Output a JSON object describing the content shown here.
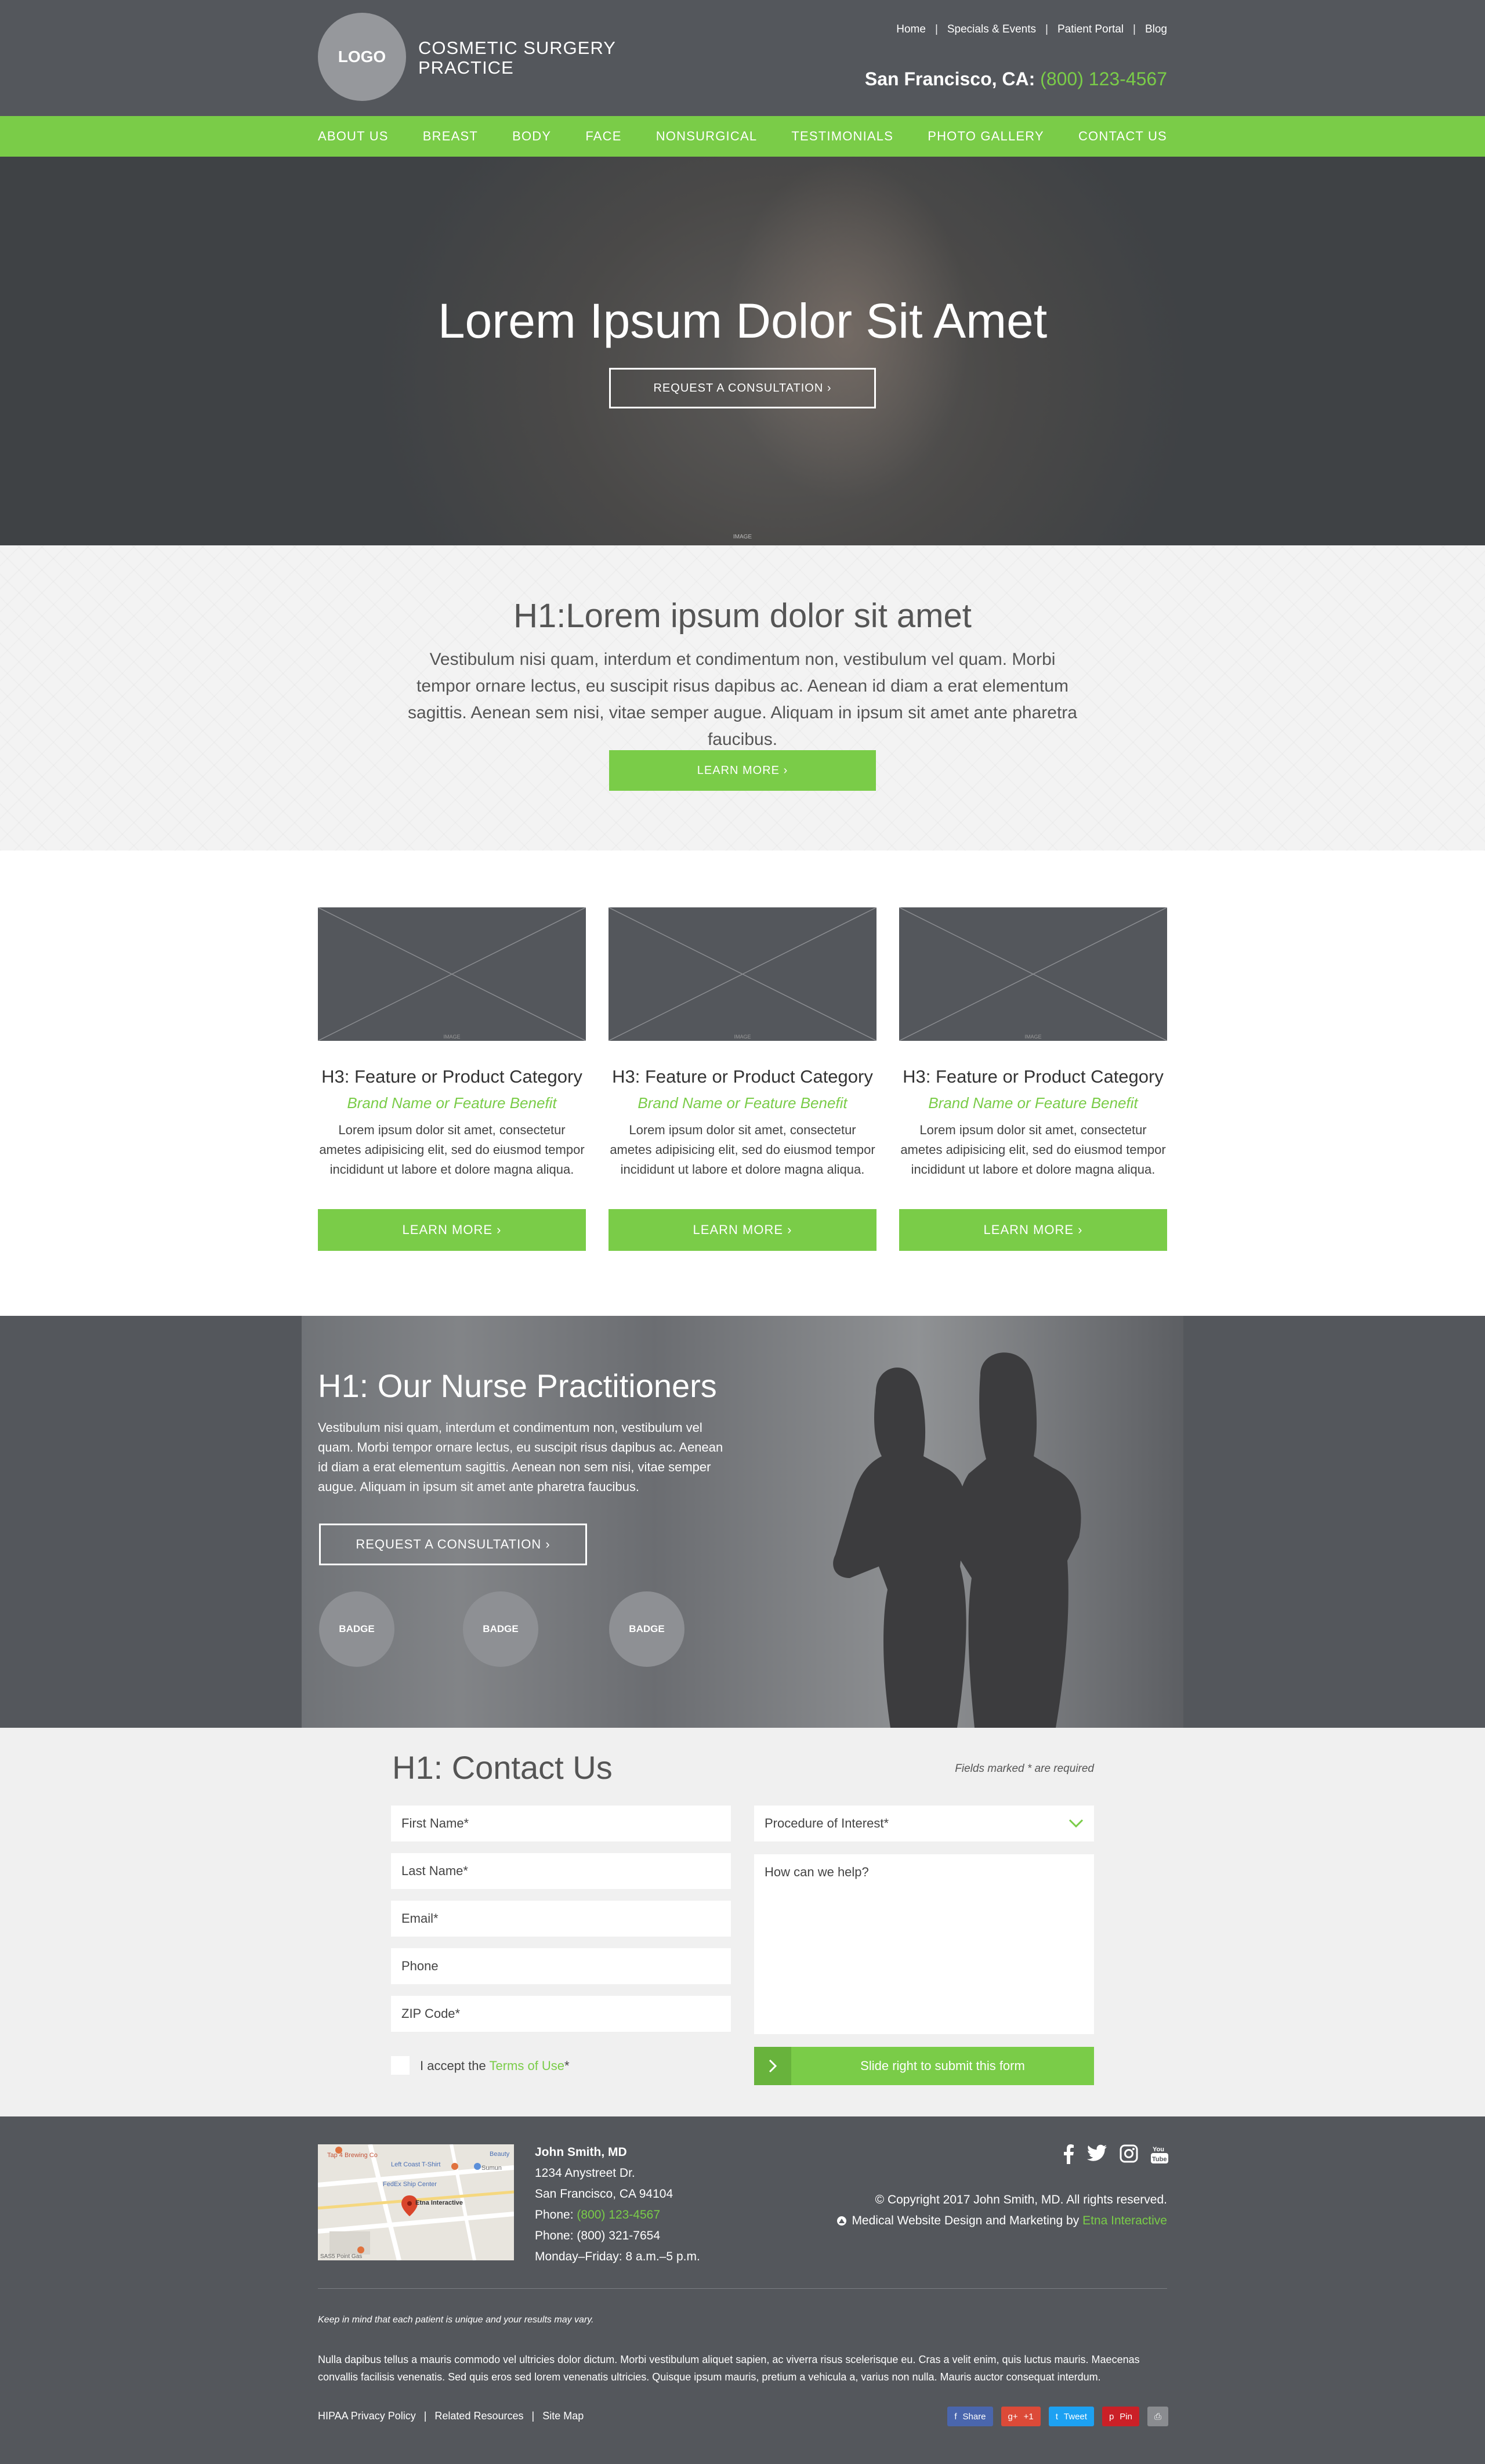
{
  "header": {
    "logo": "LOGO",
    "practice_line1": "COSMETIC SURGERY",
    "practice_line2": "PRACTICE",
    "links": [
      "Home",
      "Specials & Events",
      "Patient Portal",
      "Blog"
    ],
    "location": "San Francisco, CA:",
    "phone": "(800) 123-4567"
  },
  "nav": [
    "ABOUT US",
    "BREAST",
    "BODY",
    "FACE",
    "NONSURGICAL",
    "TESTIMONIALS",
    "PHOTO GALLERY",
    "CONTACT US"
  ],
  "hero": {
    "title": "Lorem Ipsum Dolor Sit Amet",
    "button": "REQUEST A CONSULTATION ›",
    "caption": "IMAGE"
  },
  "intro": {
    "title": "H1:Lorem ipsum dolor sit amet",
    "text": "Vestibulum nisi quam, interdum et condimentum non, vestibulum vel quam. Morbi tempor ornare lectus, eu suscipit risus dapibus ac. Aenean id diam a erat elementum sagittis. Aenean sem nisi, vitae semper augue. Aliquam in ipsum sit amet ante pharetra faucibus.",
    "button": "LEARN MORE ›"
  },
  "features": [
    {
      "image_label": "IMAGE",
      "title": "H3: Feature or Product Category",
      "subtitle": "Brand Name or Feature Benefit",
      "text": "Lorem ipsum dolor sit amet, consectetur ametes adipisicing elit, sed do eiusmod tempor incididunt ut labore et dolore magna aliqua.",
      "button": "LEARN MORE ›"
    },
    {
      "image_label": "IMAGE",
      "title": "H3: Feature or Product Category",
      "subtitle": "Brand Name or Feature Benefit",
      "text": "Lorem ipsum dolor sit amet, consectetur ametes adipisicing elit, sed do eiusmod tempor incididunt ut labore et dolore magna aliqua.",
      "button": "LEARN MORE ›"
    },
    {
      "image_label": "IMAGE",
      "title": "H3: Feature or Product Category",
      "subtitle": "Brand Name or Feature Benefit",
      "text": "Lorem ipsum dolor sit amet, consectetur ametes adipisicing elit, sed do eiusmod tempor incididunt ut labore et dolore magna aliqua.",
      "button": "LEARN MORE ›"
    }
  ],
  "nurse": {
    "title": "H1: Our Nurse Practitioners",
    "text": "Vestibulum nisi quam, interdum et condimentum non, vestibulum vel quam. Morbi tempor ornare lectus, eu suscipit risus dapibus ac. Aenean id diam a erat elementum sagittis. Aenean non sem nisi, vitae semper augue. Aliquam in ipsum sit amet ante pharetra faucibus.",
    "button": "REQUEST A CONSULTATION ›",
    "badges": [
      "BADGE",
      "BADGE",
      "BADGE"
    ]
  },
  "contact": {
    "title": "H1: Contact Us",
    "required_note": "Fields marked * are required",
    "fields": [
      "First Name*",
      "Last Name*",
      "Email*",
      "Phone",
      "ZIP Code*"
    ],
    "procedure_placeholder": "Procedure of Interest*",
    "help_placeholder": "How can we help?",
    "terms_prefix": "I accept the ",
    "terms_link": "Terms of Use",
    "terms_suffix": "*",
    "slide_label": "Slide right to submit this form"
  },
  "footer": {
    "map_labels": [
      "Tap 4 Brewing Co",
      "Left Coast T-Shirt",
      "FedEx Ship Center",
      "Etna Interactive",
      "Sumun",
      "Beauty",
      "SAS5 Point Gas"
    ],
    "name": "John Smith, MD",
    "street": "1234 Anystreet Dr.",
    "city": "San Francisco, CA 94104",
    "phone_label": "Phone: ",
    "phone1": "(800) 123-4567",
    "phone2": "Phone: (800) 321-7654",
    "hours": "Monday–Friday: 8 a.m.–5 p.m.",
    "social_icons": [
      "facebook-icon",
      "twitter-icon",
      "instagram-icon",
      "youtube-icon"
    ],
    "copyright": "© Copyright 2017 John Smith, MD. All rights reserved.",
    "credit_prefix": "Medical Website Design and Marketing by ",
    "credit_link": "Etna Interactive",
    "disclaimer": "Keep in mind that each patient is unique and your results may vary.",
    "lorem": "Nulla dapibus tellus a mauris commodo vel ultricies dolor dictum. Morbi vestibulum aliquet sapien, ac viverra risus scelerisque eu. Cras a velit enim, quis luctus mauris. Maecenas convallis facilisis venenatis. Sed quis eros sed lorem venenatis ultricies. Quisque ipsum mauris, pretium a vehicula a, varius non nulla. Mauris auctor consequat interdum.",
    "links": [
      "HIPAA Privacy Policy",
      "Related Resources",
      "Site Map"
    ],
    "share": [
      {
        "label": "Share",
        "glyph": "f",
        "color": "#4a66ad"
      },
      {
        "label": "+1",
        "glyph": "g+",
        "color": "#dc4a38"
      },
      {
        "label": "Tweet",
        "glyph": "t",
        "color": "#1da1f2"
      },
      {
        "label": "Pin",
        "glyph": "p",
        "color": "#cb2027"
      },
      {
        "label": "",
        "glyph": "⎙",
        "color": "#8a8c90"
      }
    ]
  }
}
